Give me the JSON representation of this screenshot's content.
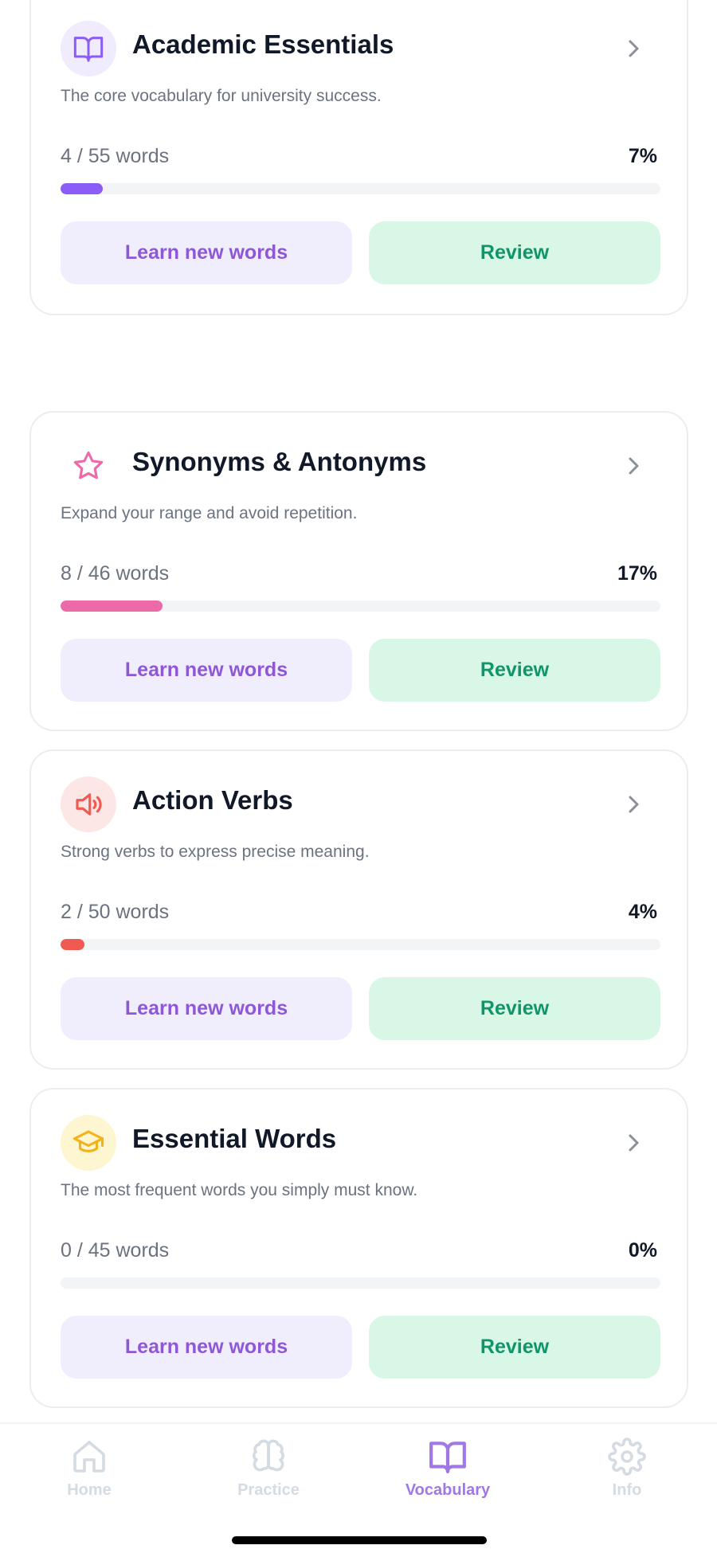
{
  "cards": [
    {
      "title": "Academic Essentials",
      "description": "The core vocabulary for university success.",
      "count": "4 / 55 words",
      "percent": "7%",
      "progress": 0.07,
      "icon": "book-open-icon",
      "accent": "#8b5cf6",
      "icon_bg": "#f0ebfd",
      "learn_label": "Learn new words",
      "review_label": "Review"
    },
    {
      "title": "Synonyms & Antonyms",
      "description": "Expand your range and avoid repetition.",
      "count": "8 / 46 words",
      "percent": "17%",
      "progress": 0.17,
      "icon": "star-icon",
      "accent": "#ec6aa8",
      "icon_bg": "#ffffff",
      "learn_label": "Learn new words",
      "review_label": "Review"
    },
    {
      "title": "Action Verbs",
      "description": "Strong verbs to express precise meaning.",
      "count": "2 / 50 words",
      "percent": "4%",
      "progress": 0.04,
      "icon": "speaker-icon",
      "accent": "#ef5a52",
      "icon_bg": "#fde7e5",
      "learn_label": "Learn new words",
      "review_label": "Review"
    },
    {
      "title": "Essential Words",
      "description": "The most frequent words you simply must know.",
      "count": "0 / 45 words",
      "percent": "0%",
      "progress": 0.0,
      "icon": "graduation-cap-icon",
      "accent": "#f2b21c",
      "icon_bg": "#fef6d0",
      "learn_label": "Learn new words",
      "review_label": "Review"
    }
  ],
  "tabbar": {
    "items": [
      {
        "label": "Home",
        "icon": "home-icon",
        "active": false
      },
      {
        "label": "Practice",
        "icon": "brain-icon",
        "active": false
      },
      {
        "label": "Vocabulary",
        "icon": "book-open-icon",
        "active": true
      },
      {
        "label": "Info",
        "icon": "gear-icon",
        "active": false
      }
    ]
  },
  "colors": {
    "learn_bg": "#f0edfc",
    "learn_text": "#8e57d6",
    "review_bg": "#d9f7e6",
    "review_text": "#10946a",
    "tab_active": "#a078e6",
    "tab_inactive": "#d5dbe2"
  }
}
